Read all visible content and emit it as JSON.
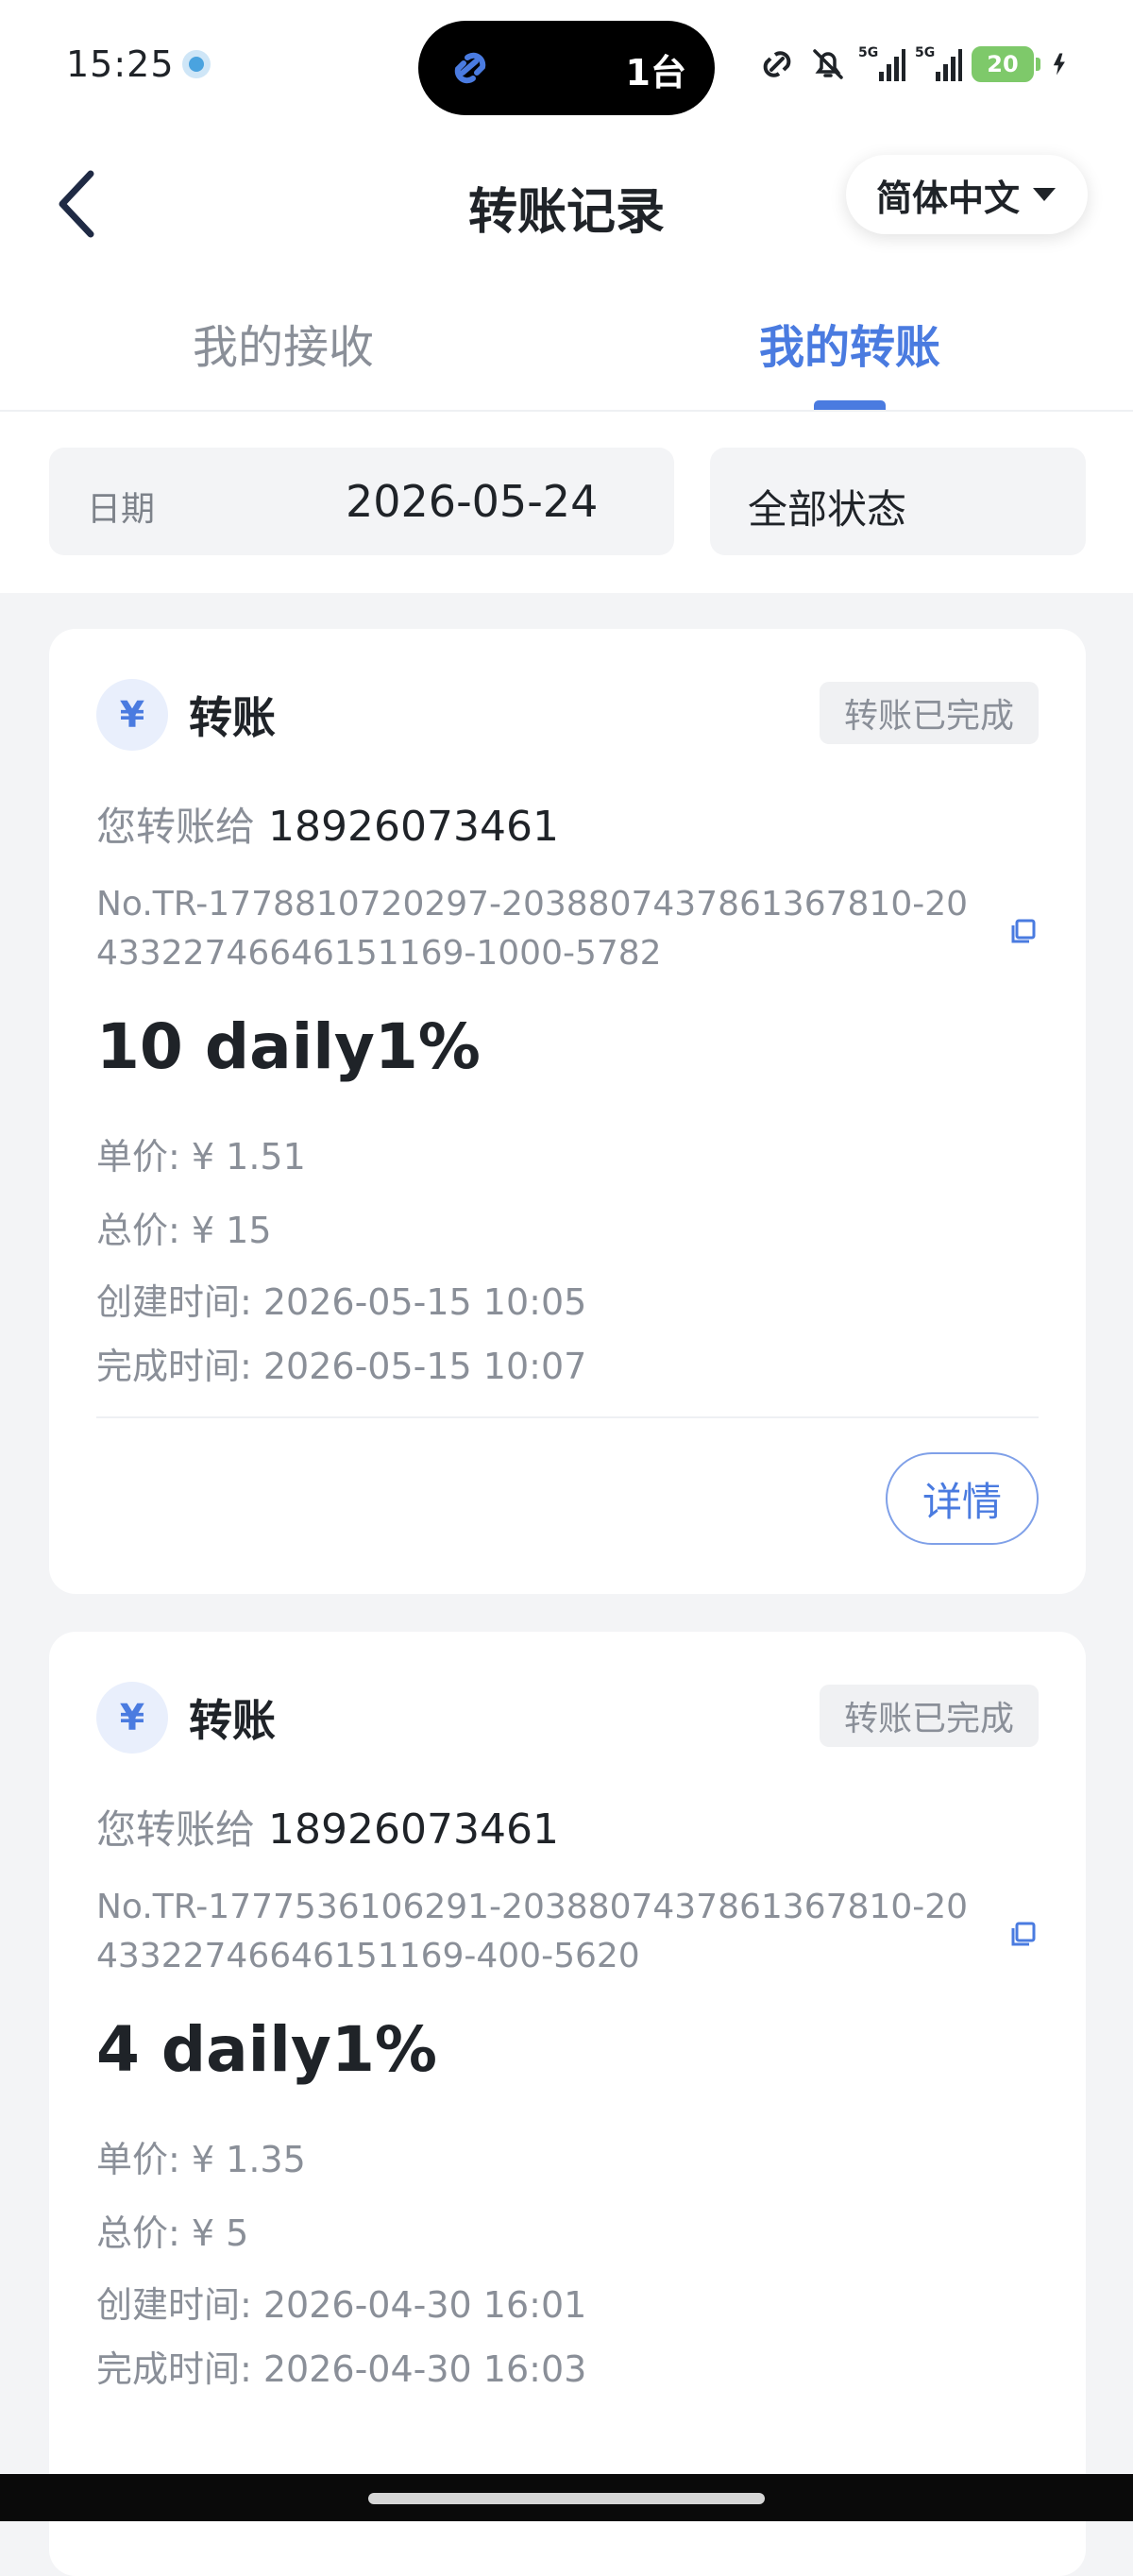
{
  "status_bar": {
    "time": "15:25",
    "island_text": "1台",
    "battery": "20",
    "icons": [
      "link-icon",
      "bell-off-icon",
      "signal-5g-icon",
      "signal-5g-icon",
      "battery-icon",
      "charging-icon"
    ]
  },
  "header": {
    "title": "转账记录",
    "language": "简体中文"
  },
  "tabs": [
    {
      "label": "我的接收",
      "active": false
    },
    {
      "label": "我的转账",
      "active": true
    }
  ],
  "filters": {
    "date_label": "日期",
    "date_value": "2026-05-24",
    "status_value": "全部状态"
  },
  "colors": {
    "accent": "#4a7be0",
    "background": "#f3f4f6",
    "muted_text": "#8a8f98"
  },
  "records": [
    {
      "icon": "¥",
      "type": "转账",
      "status": "转账已完成",
      "to_label": "您转账给",
      "to_number": "18926073461",
      "order_no": "No.TR-1778810720297-2038807437861367810-2043322746646151169-1000-5782",
      "product": "10 daily1%",
      "unit_price": "单价: ¥ 1.51",
      "total_price": "总价: ¥ 15",
      "created": "创建时间: 2026-05-15 10:05",
      "completed": "完成时间: 2026-05-15 10:07",
      "detail_label": "详情"
    },
    {
      "icon": "¥",
      "type": "转账",
      "status": "转账已完成",
      "to_label": "您转账给",
      "to_number": "18926073461",
      "order_no": "No.TR-1777536106291-2038807437861367810-2043322746646151169-400-5620",
      "product": "4 daily1%",
      "unit_price": "单价: ¥ 1.35",
      "total_price": "总价: ¥ 5",
      "created": "创建时间: 2026-04-30 16:01",
      "completed": "完成时间: 2026-04-30 16:03"
    }
  ]
}
